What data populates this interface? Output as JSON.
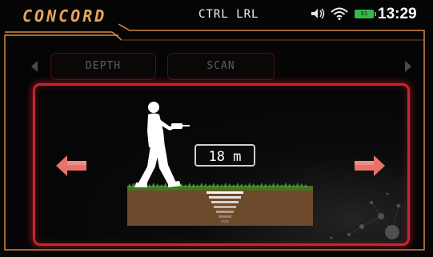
{
  "header": {
    "brand": "CONCORD",
    "mode_title": "CTRL LRL",
    "battery_level": "91",
    "clock": "13:29",
    "status_icons": [
      "volume-icon",
      "wifi-icon",
      "battery-icon"
    ]
  },
  "tabs": [
    {
      "label": "DEPTH"
    },
    {
      "label": "SCAN"
    }
  ],
  "main": {
    "depth_value": "18 m"
  },
  "colors": {
    "accent_orange": "#e9a45a",
    "panel_border_red": "#c8262d",
    "arrow_salmon": "#e8726a",
    "soil_brown": "#6e4a2c",
    "grass_green": "#3d9a2e",
    "battery_green": "#39b54a"
  }
}
